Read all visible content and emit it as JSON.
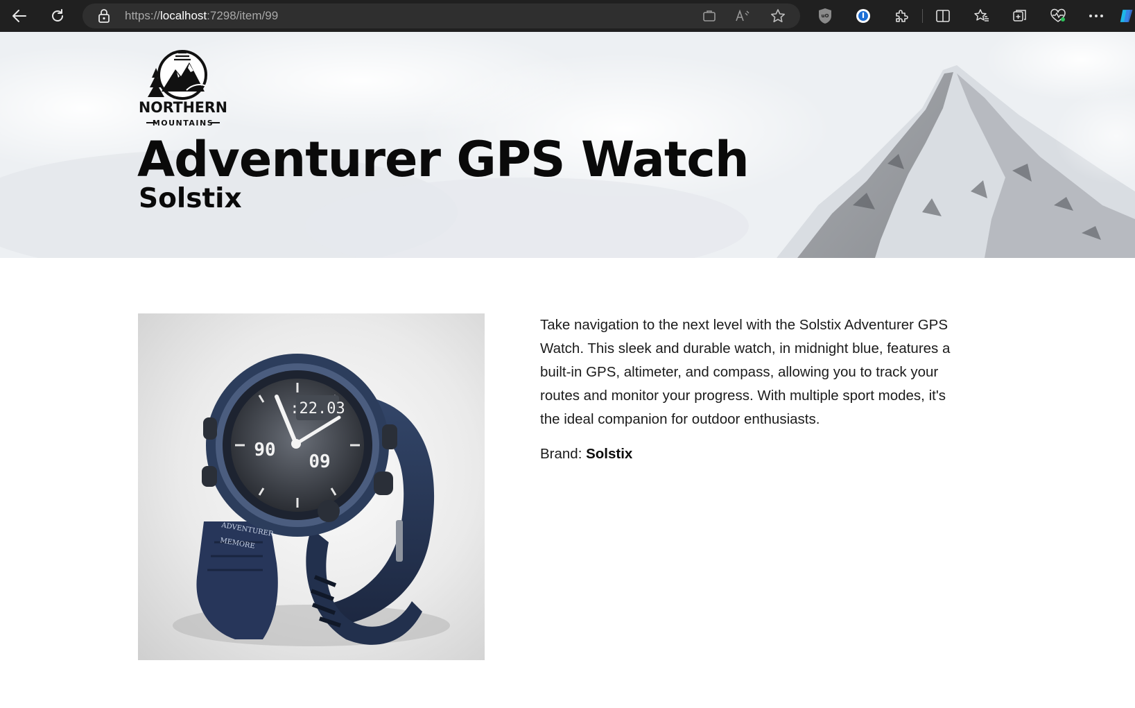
{
  "browser": {
    "url_scheme": "https://",
    "url_host": "localhost",
    "url_rest": ":7298/item/99",
    "icons": [
      "back-icon",
      "refresh-icon",
      "lock-icon",
      "app-available-icon",
      "read-aloud-icon",
      "favorite-star-icon",
      "ublock-icon",
      "password-manager-icon",
      "extensions-icon",
      "split-screen-icon",
      "favorites-icon",
      "collections-icon",
      "health-icon",
      "more-icon",
      "copilot-icon"
    ]
  },
  "hero": {
    "logo_line1": "NORTHERN",
    "logo_line2": "MOUNTAINS",
    "title": "Adventurer GPS Watch",
    "subtitle": "Solstix"
  },
  "product": {
    "image_alt": "Adventurer GPS Watch",
    "description": "Take navigation to the next level with the Solstix Adventurer GPS Watch. This sleek and durable watch, in midnight blue, features a built-in GPS, altimeter, and compass, allowing you to track your routes and monitor your progress. With multiple sport modes, it's the ideal companion for outdoor enthusiasts.",
    "brand_label": "Brand:",
    "brand_value": "Solstix",
    "watch_face_time": ":22.03",
    "watch_face_left": "90",
    "watch_face_right": "09",
    "strap_text_1": "ADVENTURER",
    "strap_text_2": "MEMORE"
  },
  "colors": {
    "chrome_bg": "#202020",
    "address_bg": "#2f2f2f",
    "watch_blue": "#2c3d5c"
  }
}
